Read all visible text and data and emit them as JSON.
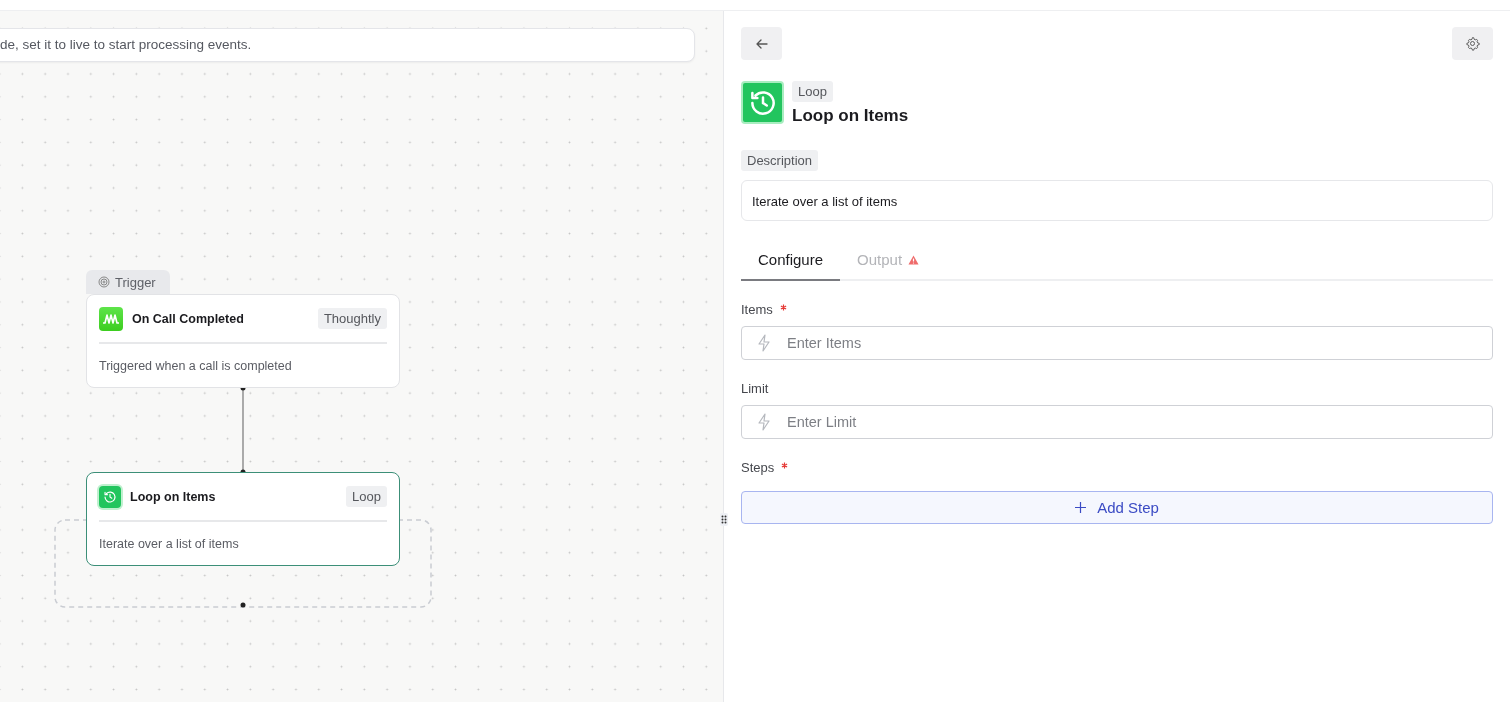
{
  "canvas": {
    "banner": "de, set it to live to start processing events.",
    "nodes": [
      {
        "kind": "trigger",
        "tab": "Trigger",
        "title": "On Call Completed",
        "badge": "Thoughtly",
        "description": "Triggered when a call is completed",
        "selected": false
      },
      {
        "kind": "loop",
        "title": "Loop on Items",
        "badge": "Loop",
        "description": "Iterate over a list of items",
        "selected": true
      }
    ]
  },
  "panel": {
    "type_badge": "Loop",
    "title": "Loop on Items",
    "description_label": "Description",
    "description": "Iterate over a list of items",
    "tabs": [
      {
        "label": "Configure",
        "selected": true,
        "warning": false
      },
      {
        "label": "Output",
        "selected": false,
        "warning": true
      }
    ],
    "fields": [
      {
        "kind": "input",
        "label": "Items",
        "required": true,
        "placeholder": "Enter Items"
      },
      {
        "kind": "input",
        "label": "Limit",
        "required": false,
        "placeholder": "Enter Limit"
      },
      {
        "kind": "button",
        "label": "Steps",
        "required": true,
        "button": "Add Step"
      }
    ]
  }
}
